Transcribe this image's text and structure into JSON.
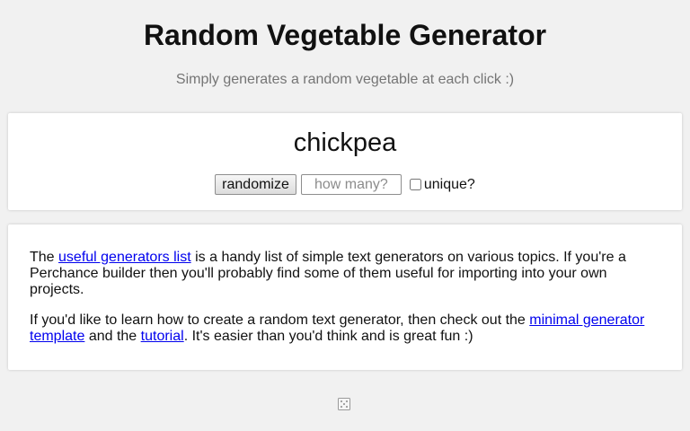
{
  "header": {
    "title": "Random Vegetable Generator",
    "subtitle": "Simply generates a random vegetable at each click :)"
  },
  "output": {
    "value": "chickpea"
  },
  "controls": {
    "randomize_label": "randomize",
    "how_many_placeholder": "how many?",
    "unique_label": "unique?",
    "unique_checked": false
  },
  "info": {
    "p1_before": "The ",
    "p1_link": "useful generators list",
    "p1_after": " is a handy list of simple text generators on various topics. If you're a Perchance builder then you'll probably find some of them useful for importing into your own projects.",
    "p2_before": "If you'd like to learn how to create a random text generator, then check out the ",
    "p2_link1": "minimal generator template",
    "p2_middle": " and the ",
    "p2_link2": "tutorial",
    "p2_after": ". It's easier than you'd think and is great fun :)"
  },
  "footer": {
    "icon": "dice-icon"
  },
  "colors": {
    "background": "#f1f1f1",
    "card": "#ffffff",
    "link": "#0000ee",
    "subtitle": "#757575"
  }
}
